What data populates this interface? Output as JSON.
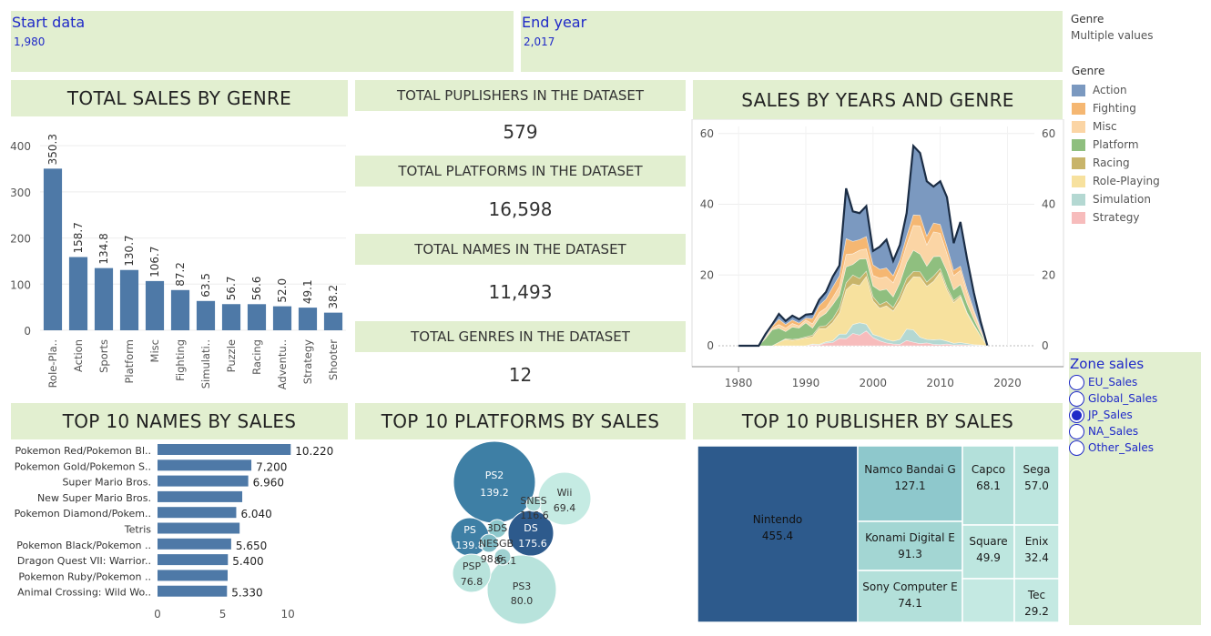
{
  "filters": {
    "start": {
      "title": "Start data",
      "value": "1,980"
    },
    "end": {
      "title": "End year",
      "value": "2,017"
    },
    "genre_filter": {
      "title": "Genre",
      "value": "Multiple values"
    }
  },
  "legend": {
    "title": "Genre",
    "items": [
      {
        "label": "Action",
        "color": "#7b99c0"
      },
      {
        "label": "Fighting",
        "color": "#f5b772"
      },
      {
        "label": "Misc",
        "color": "#fbd5a5"
      },
      {
        "label": "Platform",
        "color": "#8fbf7f"
      },
      {
        "label": "Racing",
        "color": "#c8b46a"
      },
      {
        "label": "Role-Playing",
        "color": "#f7e19e"
      },
      {
        "label": "Simulation",
        "color": "#b4d8d2"
      },
      {
        "label": "Strategy",
        "color": "#f7bcbc"
      }
    ]
  },
  "zone": {
    "title": "Zone sales",
    "options": [
      {
        "label": "EU_Sales",
        "selected": false
      },
      {
        "label": "Global_Sales",
        "selected": false
      },
      {
        "label": "JP_Sales",
        "selected": true
      },
      {
        "label": "NA_Sales",
        "selected": false
      },
      {
        "label": "Other_Sales",
        "selected": false
      }
    ]
  },
  "kpis": [
    {
      "label": "TOTAL PUPLISHERS IN THE DATASET",
      "value": "579"
    },
    {
      "label": "TOTAL PLATFORMS IN THE DATASET",
      "value": "16,598"
    },
    {
      "label": "TOTAL NAMES IN THE DATASET",
      "value": "11,493"
    },
    {
      "label": "TOTAL GENRES IN THE DATASET",
      "value": "12"
    }
  ],
  "headers": {
    "genre": "TOTAL SALES BY GENRE",
    "years": "SALES BY YEARS AND GENRE",
    "names": "TOP 10 NAMES BY SALES",
    "platforms": "TOP 10 PLATFORMS BY SALES",
    "publishers": "TOP 10 PUBLISHER BY SALES"
  },
  "chart_data": [
    {
      "type": "bar",
      "title": "TOTAL SALES BY GENRE",
      "categories": [
        "Role-Pla..",
        "Action",
        "Sports",
        "Platform",
        "Misc",
        "Fighting",
        "Simulati..",
        "Puzzle",
        "Racing",
        "Adventu..",
        "Strategy",
        "Shooter"
      ],
      "values": [
        350.3,
        158.7,
        134.8,
        130.7,
        106.7,
        87.2,
        63.5,
        56.7,
        56.6,
        52.0,
        49.1,
        38.2
      ],
      "labels": [
        "350.3",
        "158.7",
        "134.8",
        "130.7",
        "106.7",
        "87.2",
        "63.5",
        "56.7",
        "56.6",
        "52.0",
        "49.1",
        "38.2"
      ],
      "ylim": [
        0,
        420
      ],
      "yticks": [
        0,
        100,
        200,
        300,
        400
      ],
      "color": "#4e79a7"
    },
    {
      "type": "area",
      "title": "SALES BY YEARS AND GENRE",
      "x": [
        1980,
        1981,
        1982,
        1983,
        1984,
        1985,
        1986,
        1987,
        1988,
        1989,
        1990,
        1991,
        1992,
        1993,
        1994,
        1995,
        1996,
        1997,
        1998,
        1999,
        2000,
        2001,
        2002,
        2003,
        2004,
        2005,
        2006,
        2007,
        2008,
        2009,
        2010,
        2011,
        2012,
        2013,
        2014,
        2015,
        2016,
        2017
      ],
      "xlim": [
        1977,
        2024
      ],
      "xticks": [
        1980,
        1990,
        2000,
        2010,
        2020
      ],
      "ylim": [
        0,
        62
      ],
      "yticks": [
        0,
        20,
        40,
        60
      ],
      "series": [
        {
          "name": "Strategy",
          "color": "#f7bcbc",
          "values": [
            0,
            0,
            0,
            0,
            0,
            0,
            0,
            0,
            0,
            0,
            0,
            0.3,
            0.2,
            0.8,
            0.9,
            2.1,
            2.0,
            3.5,
            3.0,
            4.2,
            2.3,
            1.4,
            0.8,
            0.5,
            0.4,
            1.5,
            1.0,
            0.6,
            0.8,
            0.4,
            0.3,
            0.5,
            0.2,
            0.3,
            0.2,
            0.1,
            0.1,
            0
          ]
        },
        {
          "name": "Simulation",
          "color": "#b4d8d2",
          "values": [
            0,
            0,
            0,
            0,
            0,
            0,
            0,
            0,
            0,
            0,
            0,
            0.2,
            0.2,
            0.3,
            0.5,
            1.2,
            1.3,
            2.5,
            3.5,
            1.9,
            0.9,
            1.2,
            1.0,
            0.8,
            1.4,
            3.2,
            3.5,
            1.8,
            1.0,
            1.3,
            1.5,
            0.8,
            0.5,
            0.6,
            0.4,
            0.2,
            0.1,
            0
          ]
        },
        {
          "name": "Role-Playing",
          "color": "#f7e19e",
          "values": [
            0,
            0,
            0,
            0,
            0,
            0,
            1.0,
            1.8,
            1.5,
            1.8,
            2.2,
            2.0,
            4.5,
            3.8,
            5.2,
            6.0,
            12.5,
            11.5,
            10.5,
            13.5,
            9.5,
            8.0,
            9.5,
            8.5,
            11.0,
            12.5,
            15.0,
            17.0,
            15.0,
            16.5,
            19.0,
            14.5,
            11.5,
            13.0,
            8.5,
            5.5,
            2.5,
            0
          ]
        },
        {
          "name": "Racing",
          "color": "#c8b46a",
          "values": [
            0,
            0,
            0,
            0,
            0,
            0,
            0,
            0.2,
            0.3,
            0.2,
            0.3,
            0.5,
            0.5,
            0.8,
            1.0,
            1.5,
            2.0,
            2.5,
            2.0,
            1.5,
            1.2,
            1.0,
            1.2,
            1.0,
            1.5,
            1.8,
            1.5,
            1.5,
            1.2,
            1.5,
            1.0,
            0.8,
            0.6,
            0.4,
            0.3,
            0.2,
            0.1,
            0
          ]
        },
        {
          "name": "Platform",
          "color": "#8fbf7f",
          "values": [
            0,
            0,
            0,
            0,
            2.0,
            4.5,
            4.0,
            2.0,
            3.5,
            3.0,
            4.0,
            2.0,
            2.5,
            3.5,
            4.0,
            3.5,
            4.5,
            3.0,
            5.5,
            3.5,
            3.0,
            4.0,
            3.5,
            3.0,
            3.5,
            4.5,
            6.0,
            5.0,
            4.5,
            5.5,
            3.5,
            4.5,
            3.0,
            3.0,
            2.5,
            1.5,
            0.8,
            0
          ]
        },
        {
          "name": "Misc",
          "color": "#fbd5a5",
          "values": [
            0,
            0,
            0,
            0,
            0.5,
            0.5,
            1.0,
            1.0,
            1.0,
            0.6,
            0.8,
            1.2,
            1.5,
            1.5,
            2.0,
            2.5,
            3.5,
            3.0,
            2.5,
            2.8,
            3.0,
            3.5,
            3.5,
            4.0,
            4.5,
            5.0,
            7.0,
            8.0,
            6.0,
            7.0,
            6.5,
            5.0,
            4.0,
            4.0,
            3.0,
            2.0,
            1.0,
            0
          ]
        },
        {
          "name": "Fighting",
          "color": "#f5b772",
          "values": [
            0,
            0,
            0,
            0,
            0,
            0.5,
            1.5,
            1.0,
            1.0,
            0.8,
            0.5,
            1.5,
            2.0,
            2.5,
            3.0,
            3.0,
            4.5,
            3.5,
            3.0,
            3.5,
            3.0,
            2.5,
            2.5,
            2.0,
            2.0,
            2.5,
            3.0,
            3.0,
            2.5,
            2.5,
            2.5,
            2.0,
            1.5,
            1.2,
            1.0,
            0.7,
            0.3,
            0
          ]
        },
        {
          "name": "Action",
          "color": "#7b99c0",
          "values": [
            0,
            0,
            0,
            0,
            0.8,
            0.5,
            1.5,
            1.0,
            1.2,
            1.1,
            1.0,
            1.3,
            1.6,
            2.0,
            2.9,
            2.9,
            14.2,
            8.5,
            7.5,
            8.6,
            3.9,
            6.4,
            8.0,
            4.2,
            4.2,
            6.5,
            19.5,
            17.6,
            15.5,
            10.3,
            12.2,
            13.9,
            7.7,
            12.5,
            8.6,
            4.8,
            2.0,
            0.1
          ]
        }
      ]
    },
    {
      "type": "bar",
      "orientation": "horizontal",
      "title": "TOP 10 NAMES BY SALES",
      "categories": [
        "Pokemon Red/Pokemon Bl..",
        "Pokemon Gold/Pokemon S..",
        "Super Mario Bros.",
        "New Super Mario Bros.",
        "Pokemon Diamond/Pokem..",
        "Tetris",
        "Pokemon Black/Pokemon ..",
        "Dragon Quest VII: Warrior..",
        "Pokemon Ruby/Pokemon ..",
        "Animal Crossing: Wild Wo.."
      ],
      "values": [
        10.22,
        7.2,
        6.96,
        6.5,
        6.04,
        6.3,
        5.65,
        5.4,
        5.38,
        5.33
      ],
      "labels": [
        "10.220",
        "7.200",
        "6.960",
        "",
        "6.040",
        "",
        "5.650",
        "5.400",
        "",
        "5.330"
      ],
      "xlim": [
        0,
        14
      ],
      "xticks": [
        0,
        5,
        10
      ],
      "color": "#4e79a7"
    },
    {
      "type": "bubble",
      "title": "TOP 10 PLATFORMS BY SALES",
      "items": [
        {
          "label": "PS2",
          "value": 139.2,
          "shown": "139.2",
          "color": "#3e7fa5"
        },
        {
          "label": "PS3",
          "value": 80.0,
          "shown": "80.0",
          "color": "#b8e3dc"
        },
        {
          "label": "DS",
          "value": 175.6,
          "shown": "175.6",
          "color": "#2d5a8c"
        },
        {
          "label": "PS",
          "value": 139.8,
          "shown": "139.8",
          "color": "#3e7fa5"
        },
        {
          "label": "Wii",
          "value": 69.4,
          "shown": "69.4",
          "color": "#c5ebe3"
        },
        {
          "label": "PSP",
          "value": 76.8,
          "shown": "76.8",
          "color": "#b8e3dc"
        },
        {
          "label": "SNES",
          "value": 116.6,
          "shown": "116.6",
          "color": "#a9dad6"
        },
        {
          "label": "3DS",
          "value": 98.6,
          "shown": "98.6",
          "color": "#8ec8cc"
        },
        {
          "label": "NES",
          "value": 98.6,
          "shown": "",
          "color": "#7fbac4"
        },
        {
          "label": "GB",
          "value": 85.1,
          "shown": "85.1",
          "color": "#9fd1d1"
        }
      ]
    },
    {
      "type": "treemap",
      "title": "TOP 10 PUBLISHER BY SALES",
      "items": [
        {
          "label": "Nintendo",
          "value": 455.4,
          "shown": "455.4",
          "color": "#2d5a8c"
        },
        {
          "label": "Namco Bandai G",
          "value": 127.1,
          "shown": "127.1",
          "color": "#8ec8cc"
        },
        {
          "label": "Konami Digital E",
          "value": 91.3,
          "shown": "91.3",
          "color": "#a3d6d3"
        },
        {
          "label": "Sony Computer E",
          "value": 74.1,
          "shown": "74.1",
          "color": "#b3e0da"
        },
        {
          "label": "Capco",
          "value": 68.1,
          "shown": "68.1",
          "color": "#b3e0da"
        },
        {
          "label": "Sega",
          "value": 57.0,
          "shown": "57.0",
          "color": "#bde6df"
        },
        {
          "label": "Square",
          "value": 49.9,
          "shown": "49.9",
          "color": "#bde6df"
        },
        {
          "label": "Enix",
          "value": 32.4,
          "shown": "32.4",
          "color": "#c4e9e2"
        },
        {
          "label": "",
          "value": 30.0,
          "shown": "",
          "color": "#c4e9e2"
        },
        {
          "label": "Tec",
          "value": 29.2,
          "shown": "29.2",
          "color": "#c4e9e2"
        }
      ]
    }
  ]
}
